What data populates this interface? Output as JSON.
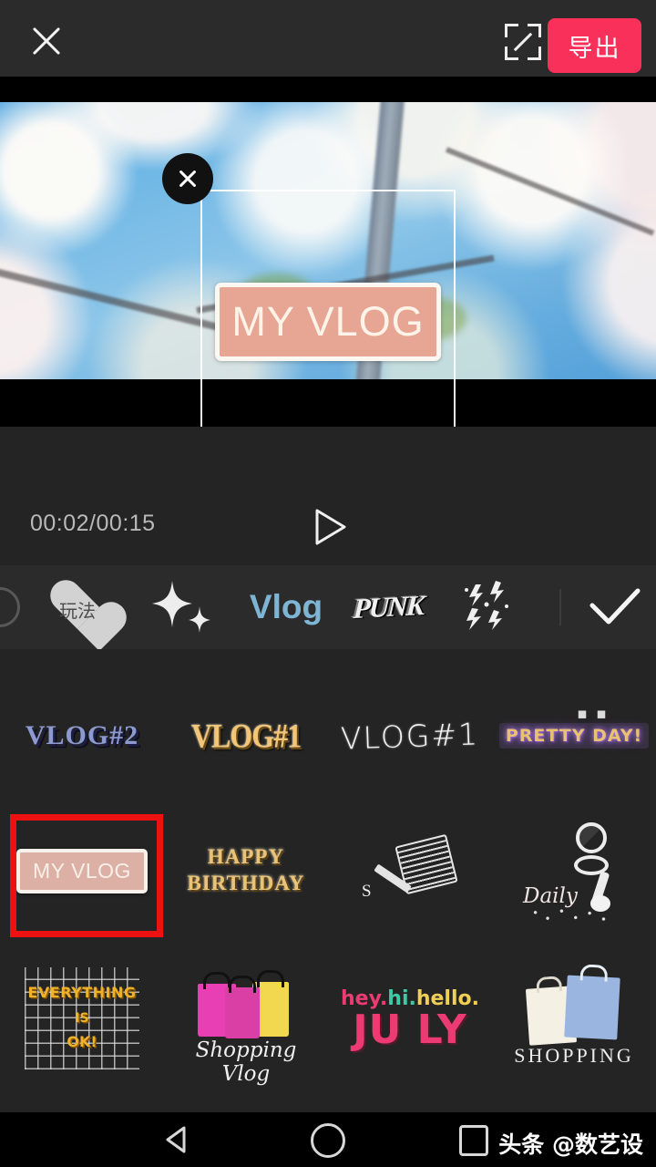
{
  "topbar": {
    "close_icon": "close-icon",
    "fullscreen_icon": "fullscreen-expand-icon",
    "export_label": "导出"
  },
  "preview": {
    "sticker_text": "MY VLOG",
    "sticker_bg_color": "#e7a693",
    "sticker_border_color": "#fdf7f2",
    "sticker_text_color": "#fdf3e8",
    "frame_close_icon": "close-icon",
    "frame_resize_icon": "resize-rotate-icon"
  },
  "player": {
    "timecode": "00:02/00:15",
    "current_time": "00:02",
    "total_time": "00:15",
    "play_icon": "play-icon"
  },
  "tabs": {
    "active_color": "#7fb5d4",
    "items": [
      {
        "id": "edge",
        "label": "",
        "icon": "circle-icon",
        "active": false
      },
      {
        "id": "玩法",
        "label": "玩法",
        "icon": "heart-icon",
        "active": false
      },
      {
        "id": "sparkle",
        "label": "",
        "icon": "sparkle-icon",
        "active": false
      },
      {
        "id": "vlog",
        "label": "Vlog",
        "icon": "vlog-text-icon",
        "active": true
      },
      {
        "id": "punk",
        "label": "PUNK",
        "icon": "punk-grunge-text-icon",
        "active": false
      },
      {
        "id": "zap",
        "label": "",
        "icon": "lightning-sparkle-icon",
        "active": false
      }
    ],
    "confirm_icon": "checkmark-icon"
  },
  "grid": {
    "rows": [
      {
        "cells": [
          {
            "id": "vlog-2",
            "label": "VLOG#2",
            "style": "blue-serif-shadow"
          },
          {
            "id": "vlog-1-gold",
            "label": "VLOG#1",
            "style": "gold-bold"
          },
          {
            "id": "vlog-1-white",
            "label": "VLOG#1",
            "style": "white-handwritten"
          },
          {
            "id": "pretty-day",
            "label": "PRETTY DAY!",
            "style": "yellow-purple-glow"
          }
        ]
      },
      {
        "cells": [
          {
            "id": "my-vlog",
            "label": "MY VLOG",
            "style": "salmon-box",
            "selected": true
          },
          {
            "id": "happy-bday",
            "label": "HAPPY\nBIRTHDAY",
            "style": "gold-serif",
            "line1": "HAPPY",
            "line2": "BIRTHDAY"
          },
          {
            "id": "note-pencil",
            "label": "",
            "style": "notepad-pencil-sketch",
            "sub": "S"
          },
          {
            "id": "daily",
            "label": "Daily",
            "style": "white-sketch-lamp"
          }
        ]
      },
      {
        "cells": [
          {
            "id": "everything-ok",
            "label": "EVERYTHING IS OK!",
            "style": "yellow-grid",
            "line1": "EVERYTHING",
            "line2": "IS",
            "line3": "OK!"
          },
          {
            "id": "shopping-vlog",
            "label": "Shopping Vlog",
            "style": "pink-bags"
          },
          {
            "id": "hey-july",
            "label": "hey.hi.hello. JULY",
            "style": "pink-yellow",
            "l1a": "hey.",
            "l1b": "hi.",
            "l1c": "hello.",
            "line2": "JU LY"
          },
          {
            "id": "shopping",
            "label": "SHOPPING",
            "style": "cream-blue-bags"
          }
        ]
      }
    ]
  },
  "annotation": {
    "color": "#ee1111",
    "target": "my-vlog"
  },
  "navbar": {
    "back_icon": "back-triangle-icon",
    "home_icon": "home-circle-icon",
    "recents_icon": "recents-square-icon",
    "watermark": "头条 @数艺设"
  }
}
